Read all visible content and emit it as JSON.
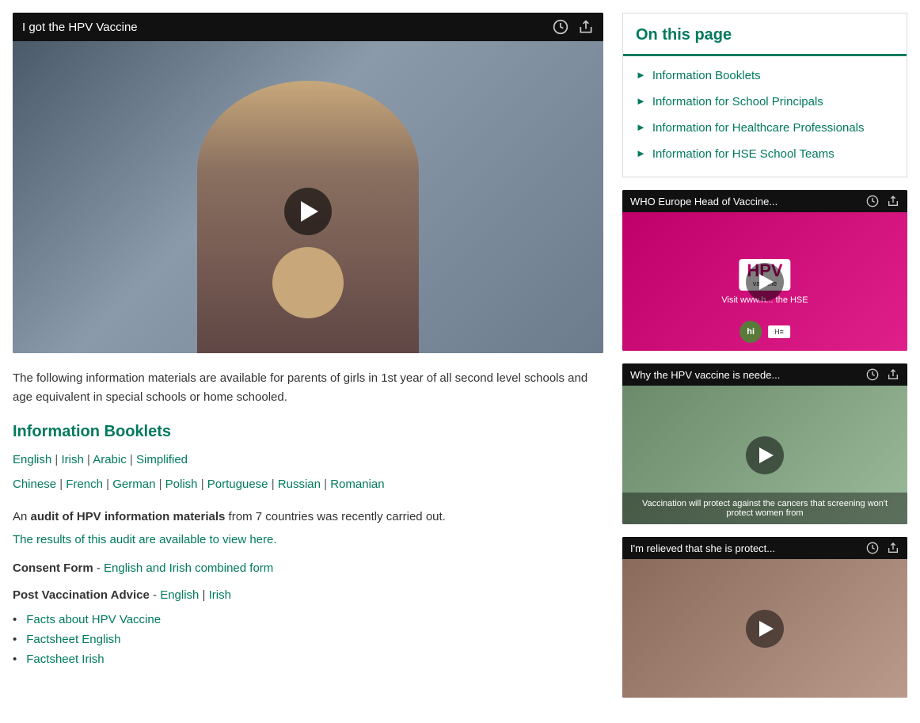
{
  "main": {
    "video": {
      "title": "I got the HPV Vaccine"
    },
    "description": "The following information materials are available for parents of girls in 1st year of all second level schools and age equivalent in special schools or home schooled.",
    "section_heading": "Information Booklets",
    "lang_row1": {
      "links": [
        "English",
        "Irish",
        "Arabic",
        "Simplified"
      ],
      "separators": [
        "|",
        "|",
        "|"
      ]
    },
    "lang_row2": {
      "links": [
        "Chinese",
        "French",
        "German",
        "Polish",
        "Portuguese",
        "Russian",
        "Romanian"
      ],
      "separators": [
        "|",
        "|",
        "|",
        "|",
        "|",
        "|"
      ]
    },
    "audit_text_pre": "An ",
    "audit_bold": "audit of HPV information materials",
    "audit_text_post": " from 7 countries was recently carried out.",
    "audit_link": "The results of this audit are available to view here.",
    "consent_form_label": "Consent Form",
    "consent_form_dash": " - ",
    "consent_form_link": "English and Irish combined form",
    "post_vacc_label": "Post Vaccination Advice",
    "post_vacc_dash": " - ",
    "post_vacc_link1": "English",
    "post_vacc_sep": " | ",
    "post_vacc_link2": "Irish",
    "bullet_items": [
      "Facts about HPV Vaccine",
      "Factsheet English",
      "Factsheet Irish"
    ]
  },
  "sidebar": {
    "on_this_page_heading": "On this page",
    "nav_items": [
      "Information Booklets",
      "Information for School Principals",
      "Information for  Healthcare Professionals",
      "Information for HSE School Teams"
    ],
    "videos": [
      {
        "title": "WHO Europe Head of Vaccine...",
        "type": "pink"
      },
      {
        "title": "Why the HPV vaccine is neede...",
        "type": "girl",
        "caption": "Vaccination will protect against the cancers that screening won't protect women from"
      },
      {
        "title": "I'm relieved that she is protect...",
        "type": "last"
      }
    ]
  },
  "colors": {
    "green": "#007a5e",
    "dark": "#111"
  }
}
